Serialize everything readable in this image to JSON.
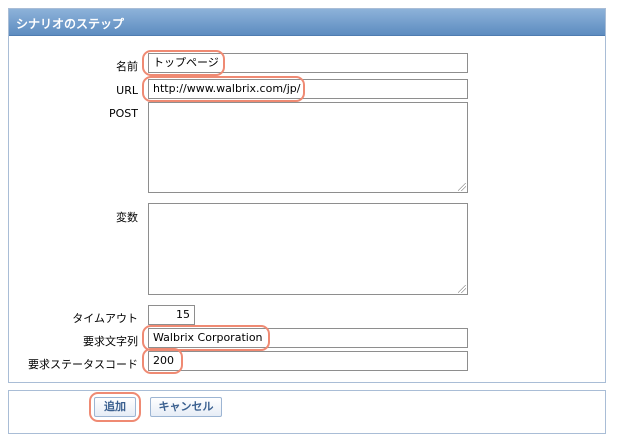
{
  "panel": {
    "title": "シナリオのステップ"
  },
  "form": {
    "name_label": "名前",
    "name_value": "トップページ",
    "url_label": "URL",
    "url_value": "http://www.walbrix.com/jp/",
    "post_label": "POST",
    "post_value": "",
    "variables_label": "変数",
    "variables_value": "",
    "timeout_label": "タイムアウト",
    "timeout_value": "15",
    "required_string_label": "要求文字列",
    "required_string_value": "Walbrix Corporation",
    "status_code_label": "要求ステータスコード",
    "status_code_value": "200"
  },
  "footer": {
    "add_label": "追加",
    "cancel_label": "キャンセル"
  },
  "colors": {
    "header_top": "#8db2d9",
    "header_bottom": "#5d8cc0",
    "highlight": "#ef8a73",
    "button_text": "#3a5f8f"
  }
}
